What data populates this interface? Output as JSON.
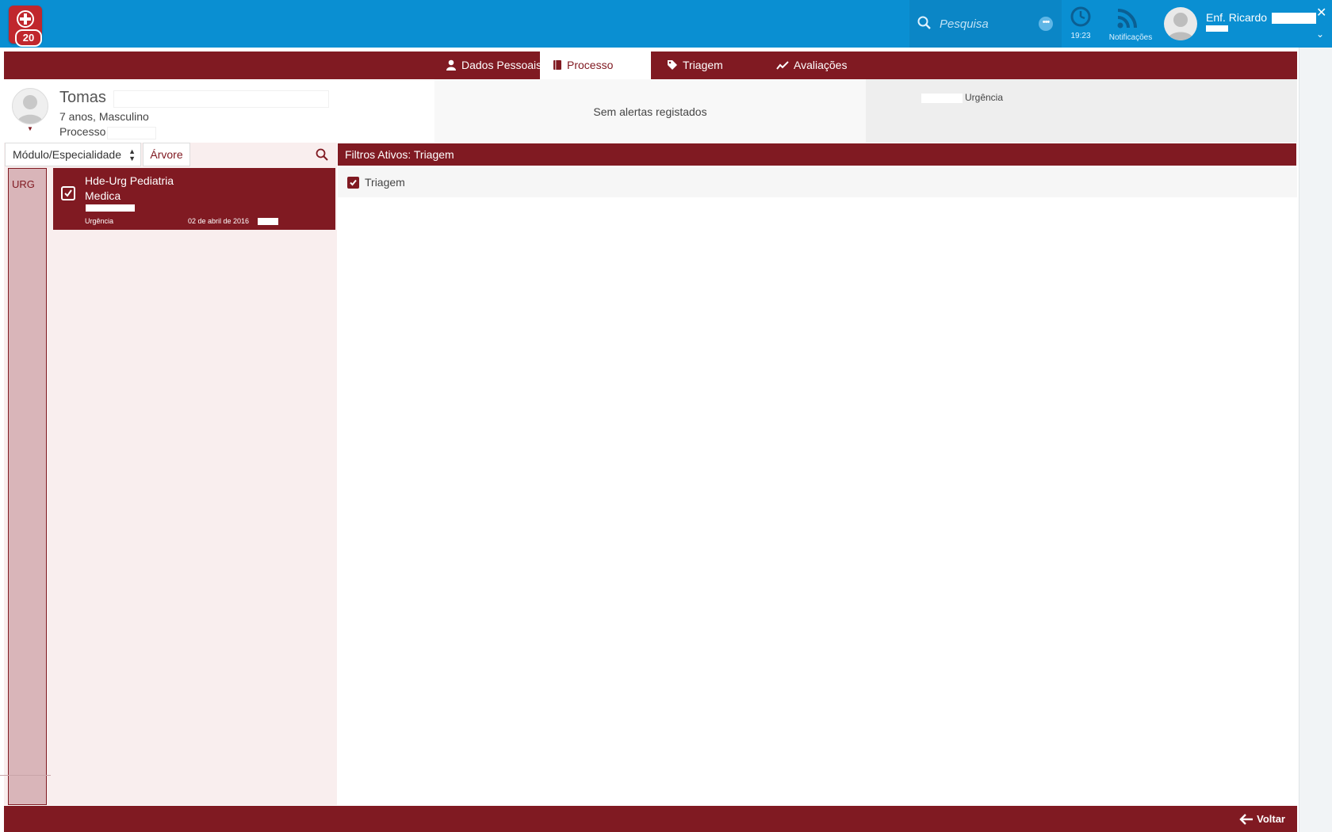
{
  "app": {
    "badge_count": "20"
  },
  "search": {
    "placeholder": "Pesquisa"
  },
  "clock": {
    "time": "19:23"
  },
  "notifications": {
    "label": "Notificações"
  },
  "user": {
    "name": "Enf. Ricardo"
  },
  "tabs": [
    {
      "label": "Dados Pessoais",
      "icon": "user-icon"
    },
    {
      "label": "Processo",
      "icon": "book-icon",
      "active": true
    },
    {
      "label": "Triagem",
      "icon": "tag-icon"
    },
    {
      "label": "Avaliações",
      "icon": "chart-icon"
    }
  ],
  "patient": {
    "name": "Tomas",
    "age_gender": "7 anos, Masculino",
    "process_label": "Processo"
  },
  "alerts": {
    "text": "Sem alertas registados"
  },
  "episode": {
    "type": "Urgência"
  },
  "sidebar": {
    "module_select": "Módulo/Especialidade",
    "tree_button": "Árvore",
    "category": "URG",
    "items": [
      {
        "title_line1": "Hde-Urg Pediatria",
        "title_line2": "Medica",
        "type": "Urgência",
        "date": "02 de abril de 2016"
      }
    ]
  },
  "filters": {
    "header": "Filtros Ativos: Triagem",
    "items": [
      {
        "label": "Triagem",
        "checked": true
      }
    ]
  },
  "footer": {
    "back_label": "Voltar"
  },
  "colors": {
    "brand": "#801a22",
    "topbar": "#0a8fd2",
    "category": "#d9b5b9"
  }
}
